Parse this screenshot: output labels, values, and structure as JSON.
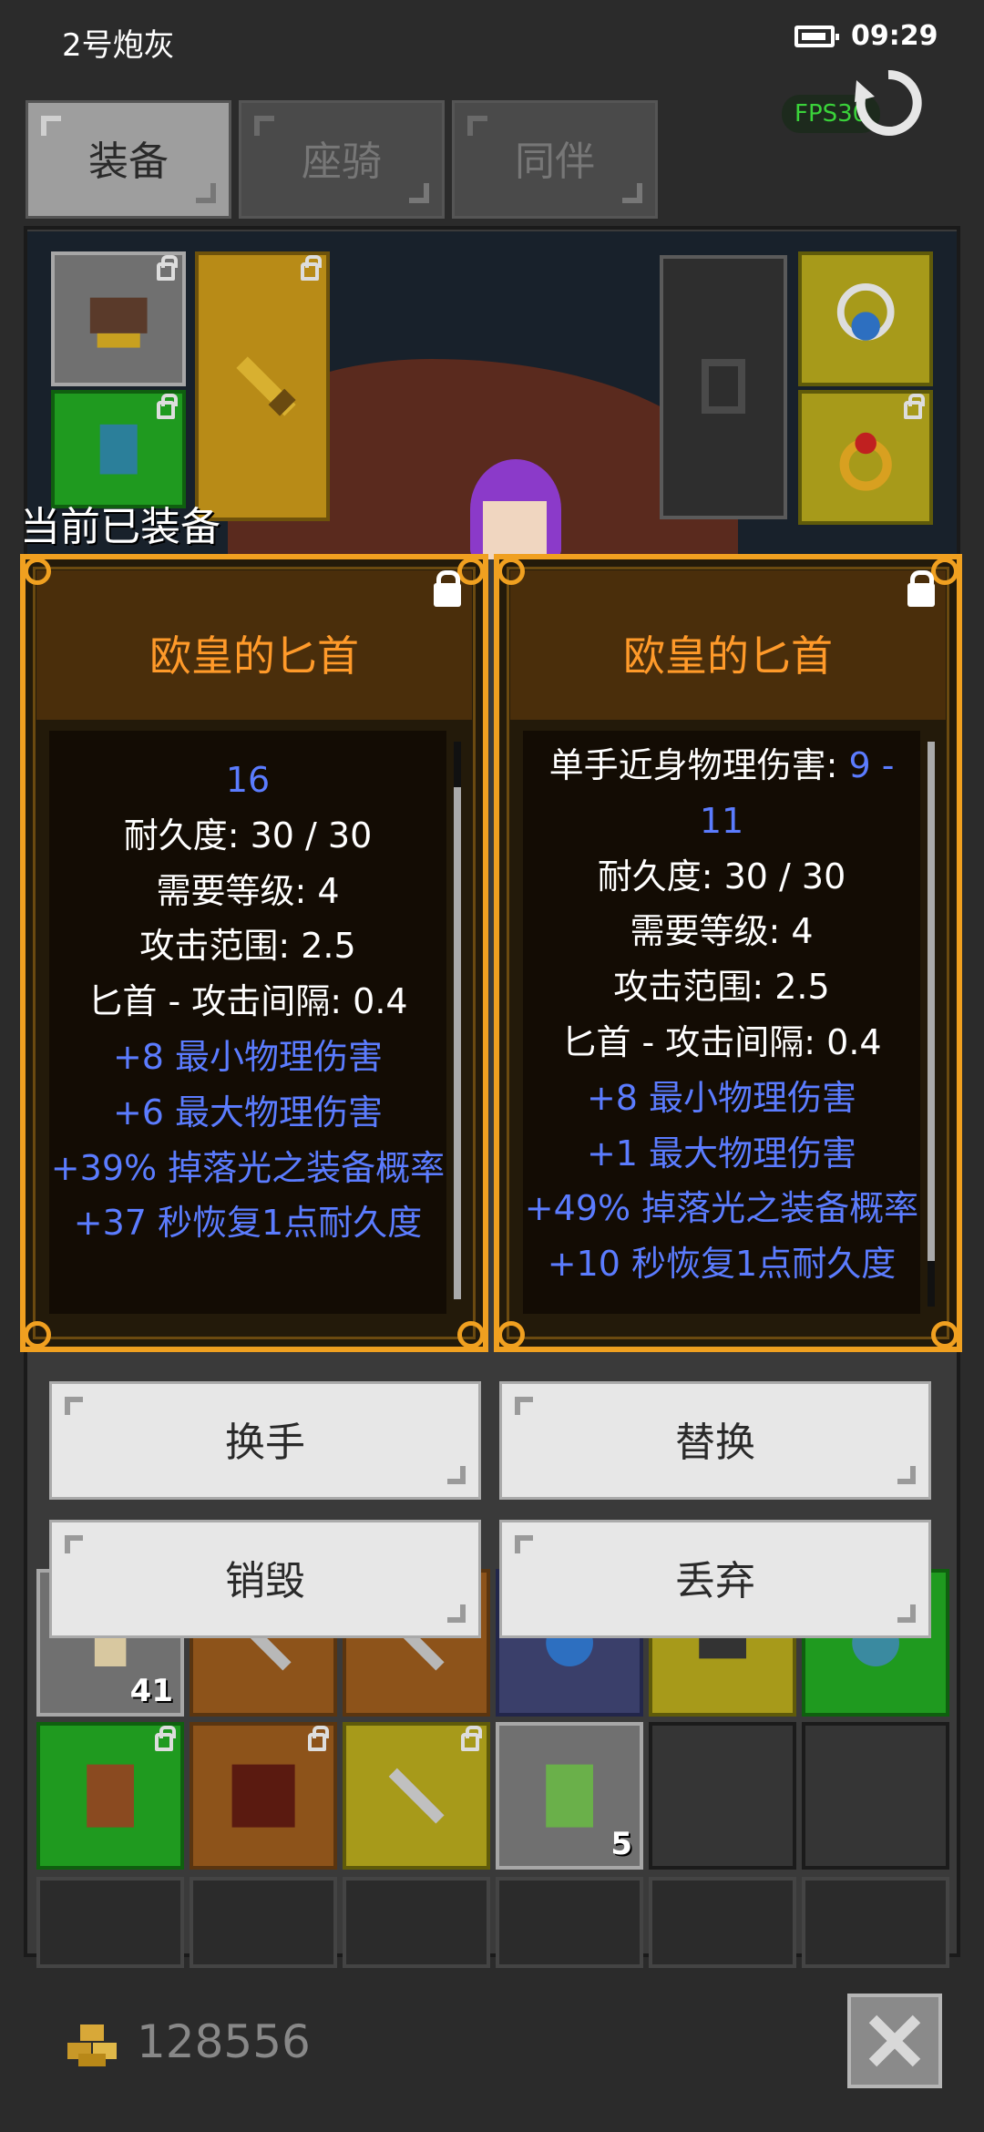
{
  "status_bar": {
    "carrier": "2号炮灰",
    "time": "09:29"
  },
  "fps_badge": "FPS30",
  "tabs": [
    {
      "label": "装备",
      "active": true
    },
    {
      "label": "座骑",
      "active": false
    },
    {
      "label": "同伴",
      "active": false
    }
  ],
  "equipped_label": "当前已装备",
  "tooltips": [
    {
      "title": "欧皇的匕首",
      "lines": [
        {
          "text": "16",
          "color": "blue"
        },
        {
          "text": "耐久度: 30 / 30",
          "color": "white"
        },
        {
          "text": "需要等级: 4",
          "color": "white"
        },
        {
          "text": "攻击范围: 2.5",
          "color": "white"
        },
        {
          "text": "匕首 - 攻击间隔: 0.4",
          "color": "white"
        },
        {
          "text": "+8 最小物理伤害",
          "color": "blue"
        },
        {
          "text": "+6 最大物理伤害",
          "color": "blue"
        },
        {
          "text": "+39% 掉落光之装备概率",
          "color": "blue"
        },
        {
          "text": "+37 秒恢复1点耐久度",
          "color": "blue"
        }
      ]
    },
    {
      "title": "欧皇的匕首",
      "lines": [
        {
          "text": "单手近身物理伤害: ",
          "extra": "9 -",
          "color": "white"
        },
        {
          "text": "11",
          "color": "blue"
        },
        {
          "text": "耐久度: 30 / 30",
          "color": "white"
        },
        {
          "text": "需要等级: 4",
          "color": "white"
        },
        {
          "text": "攻击范围: 2.5",
          "color": "white"
        },
        {
          "text": "匕首 - 攻击间隔: 0.4",
          "color": "white"
        },
        {
          "text": "+8 最小物理伤害",
          "color": "blue"
        },
        {
          "text": "+1 最大物理伤害",
          "color": "blue"
        },
        {
          "text": "+49% 掉落光之装备概率",
          "color": "blue"
        },
        {
          "text": "+10 秒恢复1点耐久度",
          "color": "blue"
        }
      ]
    }
  ],
  "actions": {
    "swap_hand": "换手",
    "replace": "替换",
    "destroy": "销毁",
    "discard": "丢弃"
  },
  "inventory": {
    "visible_quantities": [
      "41",
      "5"
    ]
  },
  "gold": "128556",
  "colors": {
    "tooltip_border": "#f0a020",
    "tooltip_title": "#ff9a2a",
    "stat_blue": "#5b7cff",
    "fps_green": "#3ad33a"
  }
}
